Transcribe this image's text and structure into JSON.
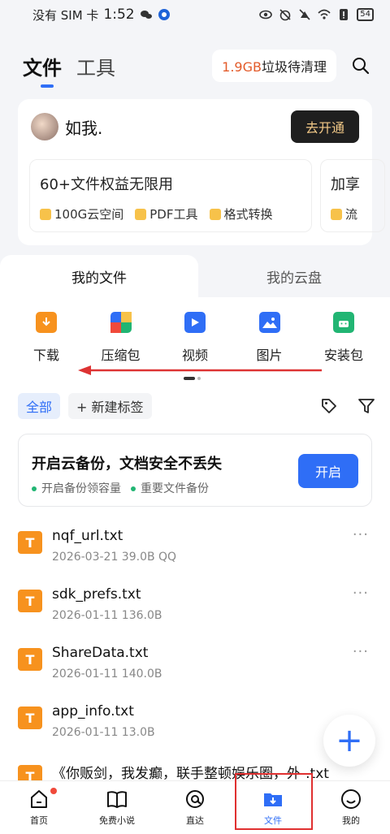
{
  "status_bar": {
    "carrier": "没有 SIM 卡",
    "time": "1:52",
    "battery": "54"
  },
  "header": {
    "tabs": [
      {
        "label": "文件"
      },
      {
        "label": "工具"
      }
    ],
    "junk_amount": "1.9GB",
    "junk_text": "垃圾待清理"
  },
  "vip": {
    "username": "如我.",
    "open_button": "去开通",
    "benefit_title": "60+文件权益无限用",
    "benefit_chips": [
      "100G云空间",
      "PDF工具",
      "格式转换"
    ],
    "benefit2_title": "加享",
    "benefit2_chip": "流"
  },
  "file_switch": {
    "left": "我的文件",
    "right": "我的云盘"
  },
  "categories": [
    {
      "label": "下载",
      "icon": "download-icon",
      "color": "#f7921e"
    },
    {
      "label": "压缩包",
      "icon": "archive-icon",
      "color": "#2f6ef6"
    },
    {
      "label": "视频",
      "icon": "video-icon",
      "color": "#2f6ef6"
    },
    {
      "label": "图片",
      "icon": "image-icon",
      "color": "#2f6ef6"
    },
    {
      "label": "安装包",
      "icon": "apk-icon",
      "color": "#21b573"
    }
  ],
  "filters": {
    "all": "全部",
    "new_tag": "+ 新建标签"
  },
  "backup": {
    "title": "开启云备份，文档安全不丢失",
    "sub1": "开启备份领容量",
    "sub2": "重要文件备份",
    "button": "开启"
  },
  "files": [
    {
      "name": "nqf_url.txt",
      "meta": "2026-03-21  39.0B  QQ"
    },
    {
      "name": "sdk_prefs.txt",
      "meta": "2026-01-11  136.0B"
    },
    {
      "name": "ShareData.txt",
      "meta": "2026-01-11  140.0B"
    },
    {
      "name": "app_info.txt",
      "meta": "2026-01-11  13.0B"
    },
    {
      "name": "《你贩剑，我发癫，联手整顿娱乐圈，外-.txt",
      "meta": ""
    }
  ],
  "bottom_nav": [
    {
      "label": "首页"
    },
    {
      "label": "免费小说"
    },
    {
      "label": "直达"
    },
    {
      "label": "文件"
    },
    {
      "label": "我的"
    }
  ],
  "colors": {
    "accent": "#2f6ef6",
    "file_icon": "#f7921e",
    "highlight": "#e03030"
  }
}
